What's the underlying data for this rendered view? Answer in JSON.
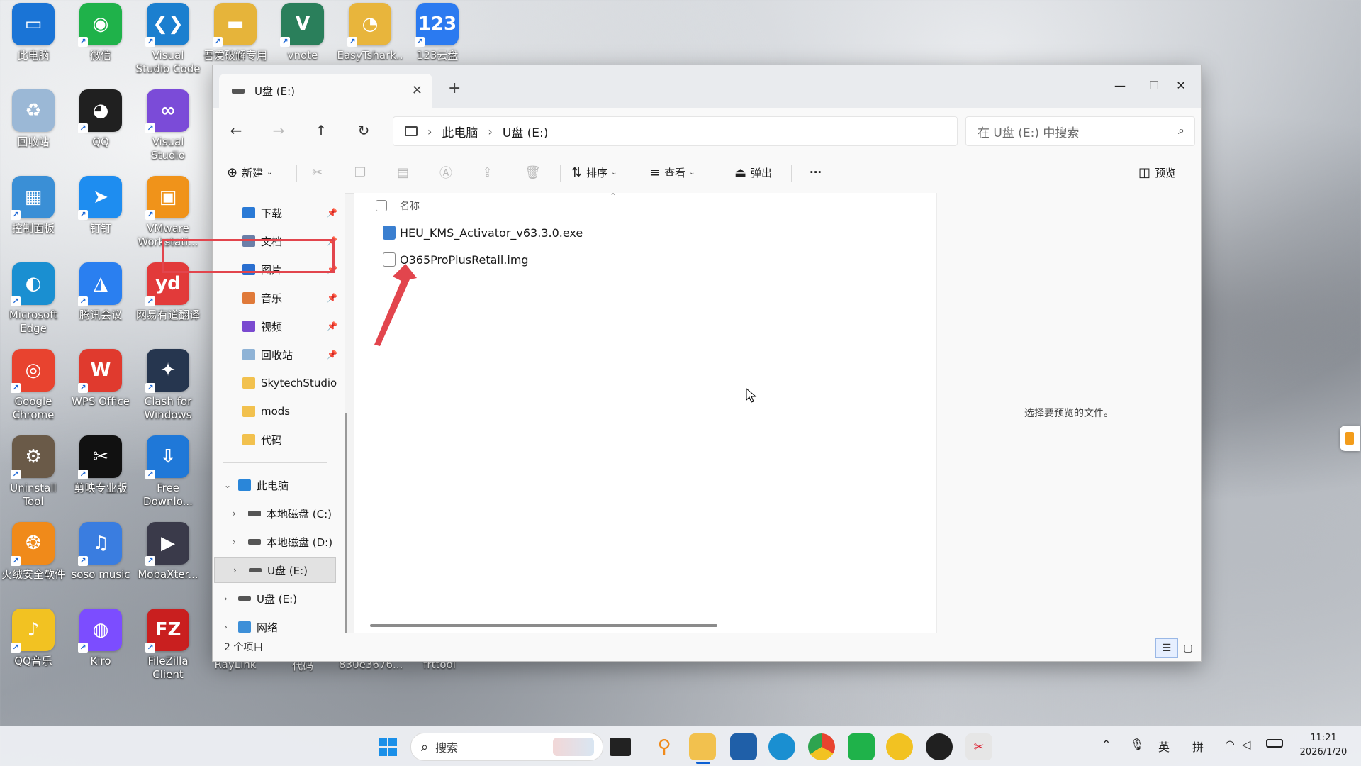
{
  "desktop": {
    "icons": [
      {
        "label": "此电脑",
        "glyph": "▭",
        "color": "#1a74d6"
      },
      {
        "label": "微信",
        "glyph": "◉",
        "color": "#1fb24a"
      },
      {
        "label": "Visual Studio Code",
        "glyph": "❮❯",
        "color": "#1b7fcf"
      },
      {
        "label": "吾爱破解专用",
        "glyph": "▬",
        "color": "#e6b43a"
      },
      {
        "label": "vnote",
        "glyph": "V",
        "color": "#2a7f5b"
      },
      {
        "label": "EasyTshark...",
        "glyph": "◔",
        "color": "#e8b53c"
      },
      {
        "label": "123云盘",
        "glyph": "123",
        "color": "#2b7af0"
      },
      {
        "label": "回收站",
        "glyph": "♻",
        "color": "#9bb8d6"
      },
      {
        "label": "QQ",
        "glyph": "◕",
        "color": "#202020"
      },
      {
        "label": "Visual Studio",
        "glyph": "∞",
        "color": "#7b4bd8"
      },
      {
        "label": "控制面板",
        "glyph": "▦",
        "color": "#3a8fd6"
      },
      {
        "label": "钉钉",
        "glyph": "➤",
        "color": "#1e8df0"
      },
      {
        "label": "VMware Workstati...",
        "glyph": "▣",
        "color": "#f0931a"
      },
      {
        "label": "Microsoft Edge",
        "glyph": "◐",
        "color": "#1a8fd1"
      },
      {
        "label": "腾讯会议",
        "glyph": "◮",
        "color": "#2a7ff0"
      },
      {
        "label": "网易有道翻译",
        "glyph": "yd",
        "color": "#e23a3a"
      },
      {
        "label": "Google Chrome",
        "glyph": "◎",
        "color": "#e8432f"
      },
      {
        "label": "WPS Office",
        "glyph": "W",
        "color": "#e03a2e"
      },
      {
        "label": "Clash for Windows",
        "glyph": "✦",
        "color": "#26364f"
      },
      {
        "label": "Uninstall Tool",
        "glyph": "⚙",
        "color": "#6a5a48"
      },
      {
        "label": "剪映专业版",
        "glyph": "✂",
        "color": "#111111"
      },
      {
        "label": "Free Downlo...",
        "glyph": "⇩",
        "color": "#1f78d8"
      },
      {
        "label": "火绒安全软件",
        "glyph": "❂",
        "color": "#f08a1a"
      },
      {
        "label": "soso music",
        "glyph": "♫",
        "color": "#3a7de0"
      },
      {
        "label": "MobaXter...",
        "glyph": "▶",
        "color": "#3a3a4a"
      },
      {
        "label": "QQ音乐",
        "glyph": "♪",
        "color": "#f2c222"
      },
      {
        "label": "Kiro",
        "glyph": "◍",
        "color": "#7c4dff"
      },
      {
        "label": "FileZilla Client",
        "glyph": "FZ",
        "color": "#c91f1f"
      }
    ],
    "behind_labels": [
      "RayLink",
      "代码",
      "830e3676...",
      "frttool"
    ]
  },
  "window": {
    "tab_title": "U盘 (E:)",
    "new_tab": "+",
    "controls": {
      "minimize": "—",
      "maximize": "☐",
      "close": "✕"
    },
    "breadcrumb": [
      "此电脑",
      "U盘 (E:)"
    ],
    "search_placeholder": "在 U盘 (E:) 中搜索",
    "toolbar": {
      "new": "新建",
      "sort": "排序",
      "view": "查看",
      "eject": "弹出",
      "more": "···",
      "preview": "预览"
    },
    "sidebar": {
      "quick": [
        {
          "label": "下载",
          "color": "#2a7ad6"
        },
        {
          "label": "文档",
          "color": "#6b7fa8"
        },
        {
          "label": "图片",
          "color": "#2a6fd0"
        },
        {
          "label": "音乐",
          "color": "#e07a3a"
        },
        {
          "label": "视频",
          "color": "#7a4ad0"
        },
        {
          "label": "回收站",
          "color": "#8fb3d6"
        }
      ],
      "folders": [
        {
          "label": "SkytechStudio",
          "color": "#f2c14e"
        },
        {
          "label": "mods",
          "color": "#f2c14e"
        },
        {
          "label": "代码",
          "color": "#f2c14e"
        }
      ],
      "this_pc": "此电脑",
      "drives": [
        "本地磁盘 (C:)",
        "本地磁盘 (D:)",
        "U盘 (E:)"
      ],
      "usb_root": "U盘 (E:)",
      "network": "网络"
    },
    "content": {
      "column_name": "名称",
      "files": [
        {
          "name": "HEU_KMS_Activator_v63.3.0.exe",
          "color": "#3a7fd0"
        },
        {
          "name": "O365ProPlusRetail.img",
          "color": "#9a9a9a"
        }
      ]
    },
    "preview_message": "选择要预览的文件。",
    "status_count": "2 个项目"
  },
  "taskbar": {
    "search_label": "搜索",
    "tray": {
      "ime_en": "英",
      "ime_pinyin": "拼"
    },
    "time": "11:21",
    "date": "2026/1/20",
    "accent": "#0b5fd3"
  },
  "accents": {
    "highlight": "#e2454d",
    "arrow": "#e2454d"
  }
}
